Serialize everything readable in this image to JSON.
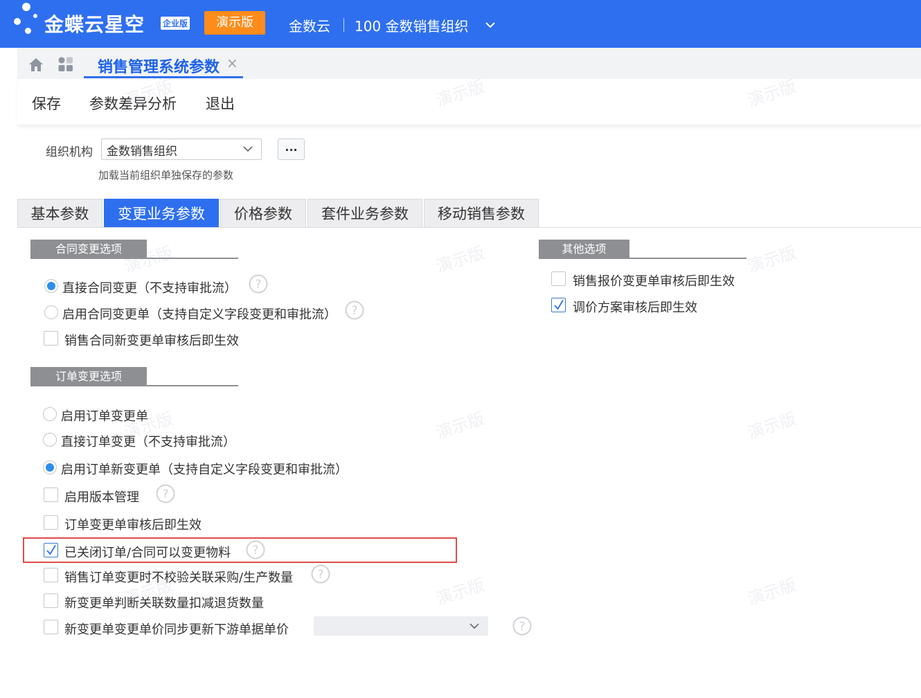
{
  "header": {
    "brand": "金蝶云星空",
    "brand_edition": "企业版",
    "demo_badge": "演示版",
    "tenant": "金数云",
    "org_switch": "100 金数销售组织"
  },
  "doc_tab": {
    "title": "销售管理系统参数",
    "close": "×"
  },
  "toolbar": {
    "save": "保存",
    "diff": "参数差异分析",
    "exit": "退出"
  },
  "org_filter": {
    "label": "组织机构",
    "value": "金数销售组织",
    "more": "...",
    "hint": "加载当前组织单独保存的参数"
  },
  "param_tabs": [
    "基本参数",
    "变更业务参数",
    "价格参数",
    "套件业务参数",
    "移动销售参数"
  ],
  "active_tab": "变更业务参数",
  "contract_group": {
    "title": "合同变更选项",
    "options": [
      {
        "type": "radio",
        "label": "直接合同变更（不支持审批流）",
        "checked": true,
        "help": true
      },
      {
        "type": "radio",
        "label": "启用合同变更单（支持自定义字段变更和审批流）",
        "checked": false,
        "help": true
      },
      {
        "type": "checkbox",
        "label": "销售合同新变更单审核后即生效",
        "checked": false,
        "help": false
      }
    ]
  },
  "order_group": {
    "title": "订单变更选项",
    "options": [
      {
        "type": "radio",
        "label": "启用订单变更单",
        "checked": false
      },
      {
        "type": "radio",
        "label": "直接订单变更（不支持审批流）",
        "checked": false
      },
      {
        "type": "radio",
        "label": "启用订单新变更单（支持自定义字段变更和审批流）",
        "checked": true
      },
      {
        "type": "checkbox",
        "label": "启用版本管理",
        "checked": false,
        "help": true
      },
      {
        "type": "checkbox",
        "label": "订单变更单审核后即生效",
        "checked": false
      },
      {
        "type": "checkbox",
        "label": "已关闭订单/合同可以变更物料",
        "checked": true,
        "help": true,
        "highlighted": true
      },
      {
        "type": "checkbox",
        "label": "销售订单变更时不校验关联采购/生产数量",
        "checked": false,
        "help": true
      },
      {
        "type": "checkbox",
        "label": "新变更单判断关联数量扣减退货数量",
        "checked": false
      },
      {
        "type": "checkbox",
        "label": "新变更单变更单价同步更新下游单据单价",
        "checked": false,
        "help": true,
        "select_value": ""
      }
    ]
  },
  "other_group": {
    "title": "其他选项",
    "options": [
      {
        "type": "checkbox",
        "label": "销售报价变更单审核后即生效",
        "checked": false
      },
      {
        "type": "checkbox",
        "label": "调价方案审核后即生效",
        "checked": true
      }
    ]
  },
  "watermark": "演示版",
  "colors": {
    "header": "#2e6ff0",
    "accent": "#2e6ff0",
    "demo_badge": "#ff8c1a",
    "group_header": "#8d8f93",
    "highlight": "#e24a4a"
  }
}
